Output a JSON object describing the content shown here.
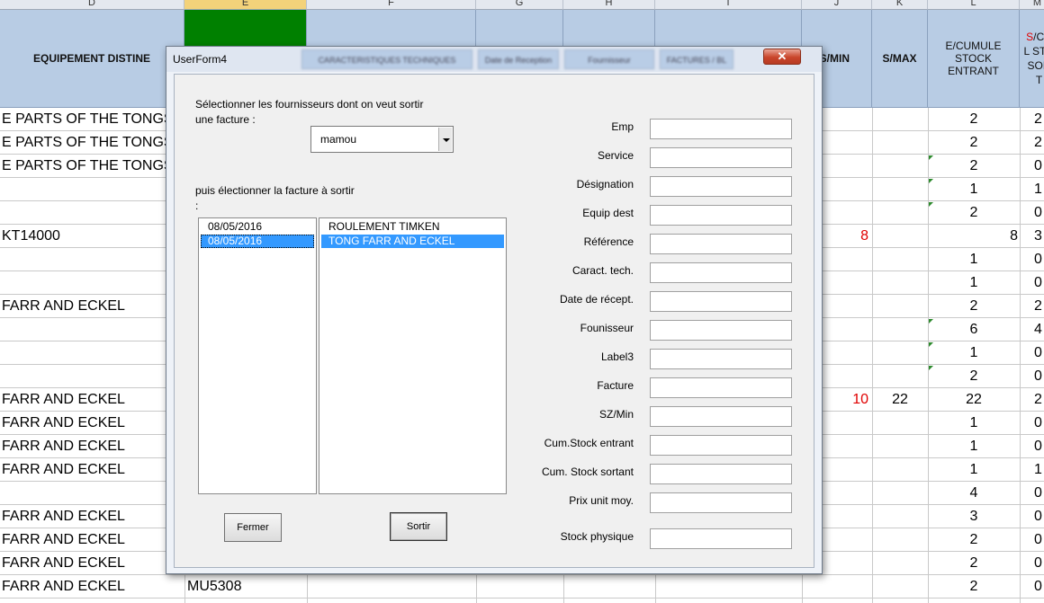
{
  "sheet": {
    "columns": [
      "D",
      "E",
      "F",
      "G",
      "H",
      "I",
      "J",
      "K",
      "L",
      "M"
    ],
    "headers": {
      "D": "EQUIPEMENT DISTINE",
      "J": "S/MIN",
      "K": "S/MAX",
      "L": "E/CUMULE STOCK ENTRANT",
      "M_prefix": "S",
      "M": "/CU L STO SOR T"
    },
    "rows": [
      {
        "d": "E PARTS OF THE TONGS",
        "l": "2",
        "m": "2"
      },
      {
        "d": "E PARTS OF THE TONGS",
        "l": "2",
        "m": "2"
      },
      {
        "d": "E PARTS OF THE TONGS",
        "l": "2",
        "m": "0"
      },
      {
        "d": "",
        "l": "1",
        "m": "1"
      },
      {
        "d": "",
        "l": "2",
        "m": "0"
      },
      {
        "d": "KT14000",
        "j": "8",
        "l": "8",
        "m": "3"
      },
      {
        "d": "",
        "l": "1",
        "m": "0"
      },
      {
        "d": "",
        "l": "1",
        "m": "0"
      },
      {
        "d": "FARR AND ECKEL",
        "l": "2",
        "m": "2"
      },
      {
        "d": "",
        "l": "6",
        "m": "4"
      },
      {
        "d": "",
        "l": "1",
        "m": "0"
      },
      {
        "d": "",
        "l": "2",
        "m": "0"
      },
      {
        "d": "FARR AND ECKEL",
        "j": "10",
        "k": "22",
        "l": "22",
        "m": "2"
      },
      {
        "d": "FARR AND ECKEL",
        "l": "1",
        "m": "0"
      },
      {
        "d": "FARR AND ECKEL",
        "l": "1",
        "m": "0"
      },
      {
        "d": "FARR AND ECKEL",
        "l": "1",
        "m": "1"
      },
      {
        "d": "",
        "l": "4",
        "m": "0"
      },
      {
        "d": "FARR AND ECKEL",
        "l": "3",
        "m": "0"
      },
      {
        "d": "FARR AND ECKEL",
        "l": "2",
        "m": "0"
      },
      {
        "d": "FARR AND ECKEL",
        "l": "2",
        "m": "0"
      },
      {
        "d": "FARR AND ECKEL",
        "e": "MU5308",
        "l": "2",
        "m": "0"
      }
    ]
  },
  "dialog": {
    "title": "UserForm4",
    "close_glyph": "✕",
    "blurred_header_tabs": [
      "CARACTERISTIQUES TECHNIQUES",
      "Date de Reception",
      "Fournisseur",
      "FACTURES / BL"
    ],
    "supplier_label": "Sélectionner les fournisseurs dont on veut sortir une facture :",
    "supplier_combo_value": "mamou",
    "invoice_label": "puis électionner la facture à sortir :",
    "dates": [
      "08/05/2016",
      "08/05/2016"
    ],
    "invoices": [
      "ROULEMENT TIMKEN",
      "TONG FARR AND ECKEL"
    ],
    "close_button": "Fermer",
    "output_button": "Sortir",
    "fields": [
      "Emp",
      "Service",
      "Désignation",
      "Equip dest",
      "Référence",
      "Caract. tech.",
      "Date de récept.",
      "Founisseur",
      "Label3",
      "Facture",
      "SZ/Min",
      "Cum.Stock entrant",
      "Cum. Stock sortant",
      "Prix unit moy.",
      "Stock physique"
    ]
  },
  "colors": {
    "accent": "#3399ff",
    "header_fill": "#b8cce4",
    "selected_col": "#008000",
    "red_text": "#e00000"
  }
}
